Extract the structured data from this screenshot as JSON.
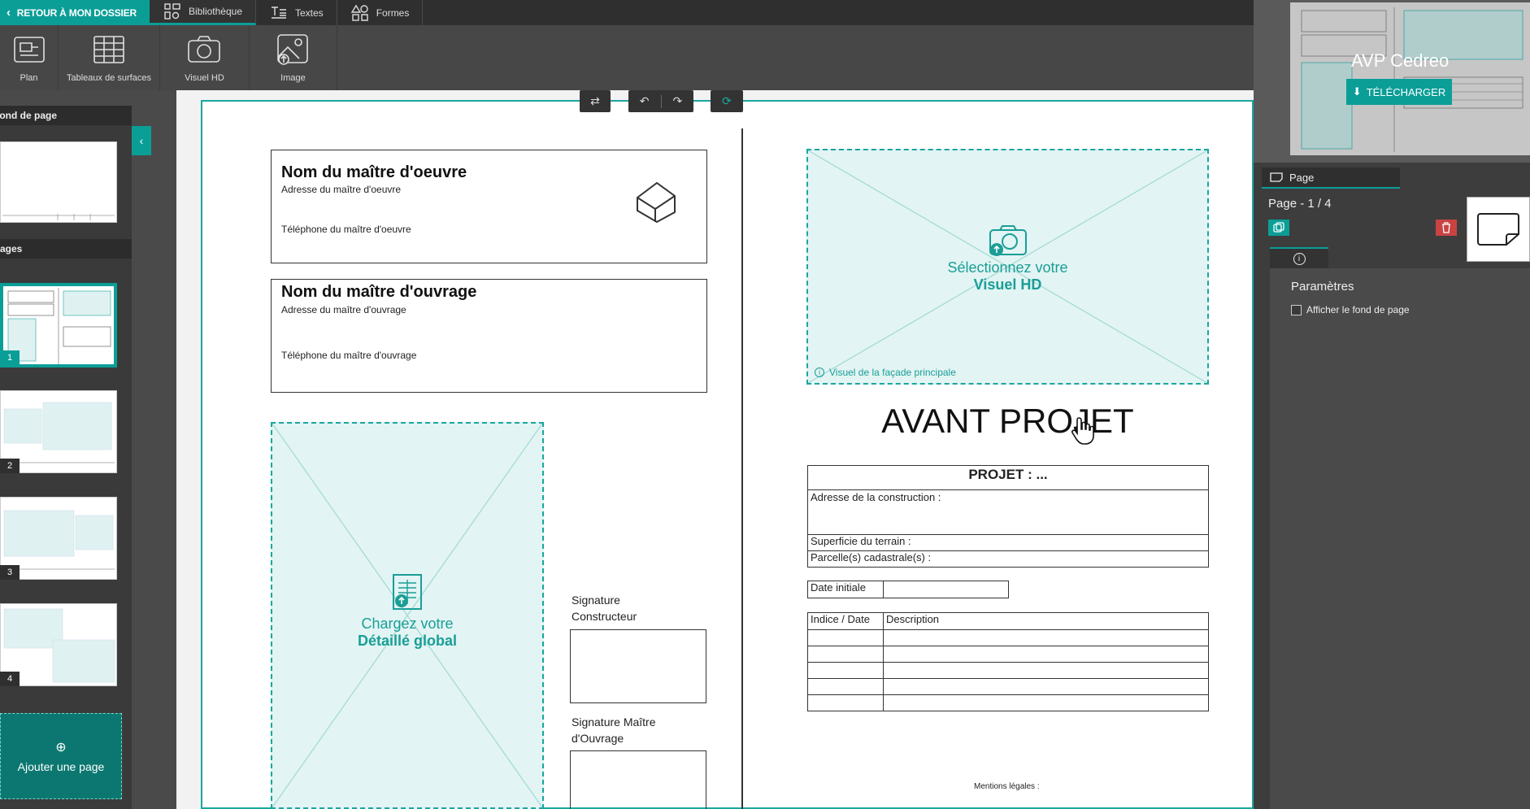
{
  "topbar": {
    "back_label": "RETOUR À MON DOSSIER",
    "tabs": [
      {
        "label": "Bibliothèque",
        "icon": "library-icon"
      },
      {
        "label": "Textes",
        "icon": "text-icon"
      },
      {
        "label": "Formes",
        "icon": "shapes-icon"
      }
    ]
  },
  "toolbar": {
    "tools": [
      {
        "label": "Plan",
        "icon": "plan-icon"
      },
      {
        "label": "Tableaux de surfaces",
        "icon": "table-icon"
      },
      {
        "label": "Visuel HD",
        "icon": "camera-icon"
      },
      {
        "label": "Image",
        "icon": "image-icon"
      }
    ]
  },
  "left_panel": {
    "background_header": "Fond de page",
    "pages_header": "Pages",
    "page_numbers": [
      "1",
      "2",
      "3",
      "4"
    ],
    "add_page_label": "Ajouter une page"
  },
  "document": {
    "moe": {
      "title": "Nom du maître d'oeuvre",
      "address": "Adresse du maître d'oeuvre",
      "phone": "Téléphone du maître d'oeuvre"
    },
    "mo": {
      "title": "Nom du maître d'ouvrage",
      "address": "Adresse du maître d'ouvrage",
      "phone": "Téléphone du maître d'ouvrage"
    },
    "detail_placeholder": {
      "line1": "Chargez votre",
      "line2": "Détaillé global"
    },
    "signature_builder": "Signature Constructeur",
    "signature_owner": "Signature Maître d'Ouvrage",
    "visual_placeholder": {
      "line1": "Sélectionnez votre",
      "line2": "Visuel HD",
      "caption": "Visuel de la façade principale"
    },
    "main_title": "AVANT PROJET",
    "project_table": {
      "header": "PROJET : ...",
      "address": "Adresse de la construction :",
      "surface": "Superficie du terrain :",
      "parcel": "Parcelle(s) cadastrale(s) :"
    },
    "date_label": "Date initiale",
    "index_header": "Indice / Date",
    "description_header": "Description",
    "legal": "Mentions légales :"
  },
  "right_panel": {
    "preview_title": "AVP Cedreo",
    "download_label": "TÉLÉCHARGER",
    "tab_label": "Page",
    "page_counter": "Page - 1 / 4",
    "section_title": "Paramètres",
    "checkbox_label": "Afficher le fond de page"
  },
  "colors": {
    "accent": "#0b9e97",
    "danger": "#c94343"
  }
}
